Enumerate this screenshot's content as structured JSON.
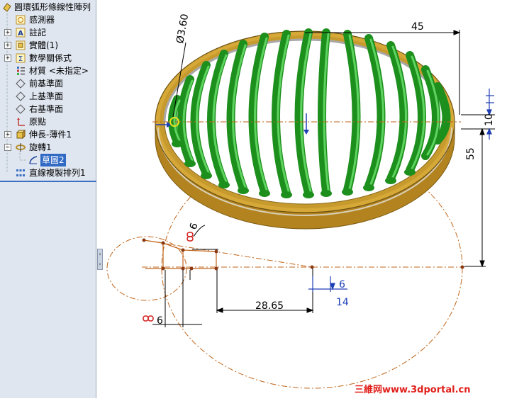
{
  "tree": {
    "items": [
      {
        "label": "圓環弧形條線性陣列",
        "icon": "part-icon"
      },
      {
        "label": "感測器",
        "icon": "sensor-icon"
      },
      {
        "label": "註記",
        "icon": "annotation-icon"
      },
      {
        "label": "實體(1)",
        "icon": "solid-bodies-icon"
      },
      {
        "label": "數學關係式",
        "icon": "equations-icon"
      },
      {
        "label": "材質 <未指定>",
        "icon": "material-icon"
      },
      {
        "label": "前基準面",
        "icon": "plane-icon"
      },
      {
        "label": "上基準面",
        "icon": "plane-icon"
      },
      {
        "label": "右基準面",
        "icon": "plane-icon"
      },
      {
        "label": "原點",
        "icon": "origin-icon"
      },
      {
        "label": "伸長-薄件1",
        "icon": "extrude-icon"
      },
      {
        "label": "旋轉1",
        "icon": "revolve-icon"
      },
      {
        "label": "草圖2",
        "icon": "sketch-icon"
      },
      {
        "label": "直線複製排列1",
        "icon": "linear-pattern-icon"
      }
    ]
  },
  "dimensions": {
    "diameter": "Ø3.60",
    "d45": "45",
    "d10": "10",
    "d55": "55",
    "d6_left": "6",
    "d6_angle": "6",
    "d6_right": "6",
    "d14": "14",
    "d2865": "28.65"
  },
  "colors": {
    "ring_outer": "#c79a2e",
    "ring_inner": "#a57c1c",
    "ribs": "#1d8f1d",
    "sketch": "#c0651a",
    "selection": "#316ac5",
    "watermark": "#e0201b"
  },
  "watermark": {
    "text": "三維网www.3dportal.cn"
  }
}
